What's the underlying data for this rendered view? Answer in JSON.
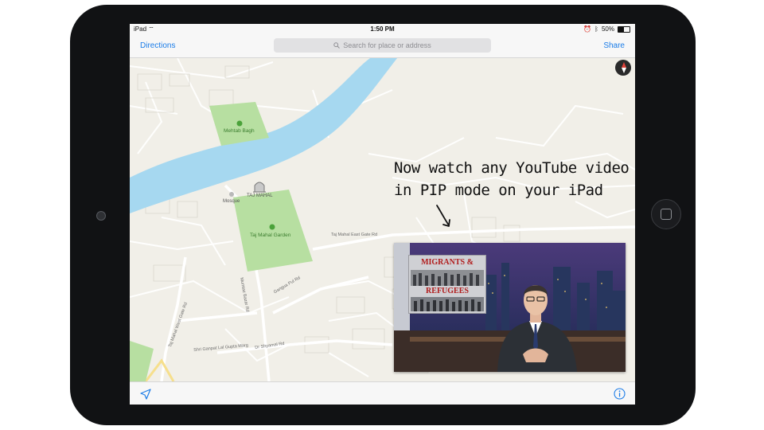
{
  "status": {
    "carrier": "iPad",
    "time": "1:50 PM",
    "battery": "50%"
  },
  "nav": {
    "directions": "Directions",
    "search_placeholder": "Search for place or address",
    "share": "Share"
  },
  "map": {
    "places": [
      {
        "key": "mehtab",
        "label": "Mehtab Bagh"
      },
      {
        "key": "tajmahal",
        "label": "TAJ MAHAL"
      },
      {
        "key": "mosque",
        "label": "Mosque"
      },
      {
        "key": "tajgarden",
        "label": "Taj Mahal Garden"
      }
    ],
    "roads": [
      {
        "key": "eastgate",
        "label": "Taj Mahal East Gate Rd"
      },
      {
        "key": "mumtaz",
        "label": "Mumtaz Bazar Rd"
      },
      {
        "key": "ganga",
        "label": "Gangua Pul Rd"
      },
      {
        "key": "westgate",
        "label": "Taj Mahal West Gate Rd"
      },
      {
        "key": "gupta",
        "label": "Shri Ganpat Lal Gupta Marg"
      },
      {
        "key": "shyamal",
        "label": "Dr Shyamal Rd"
      }
    ],
    "colors": {
      "water": "#a6d8f0",
      "park": "#b7dfa1",
      "land": "#f1efe8",
      "road": "#ffffff"
    }
  },
  "caption": {
    "line1": "Now watch any YouTube video",
    "line2": "in PIP mode on your iPad"
  },
  "pip": {
    "graphic_line1": "MIGRANTS &",
    "graphic_line2": "REFUGEES"
  },
  "icons": {
    "compass": "compass-icon",
    "location": "location-arrow-icon",
    "info": "info-icon",
    "search": "search-icon"
  }
}
